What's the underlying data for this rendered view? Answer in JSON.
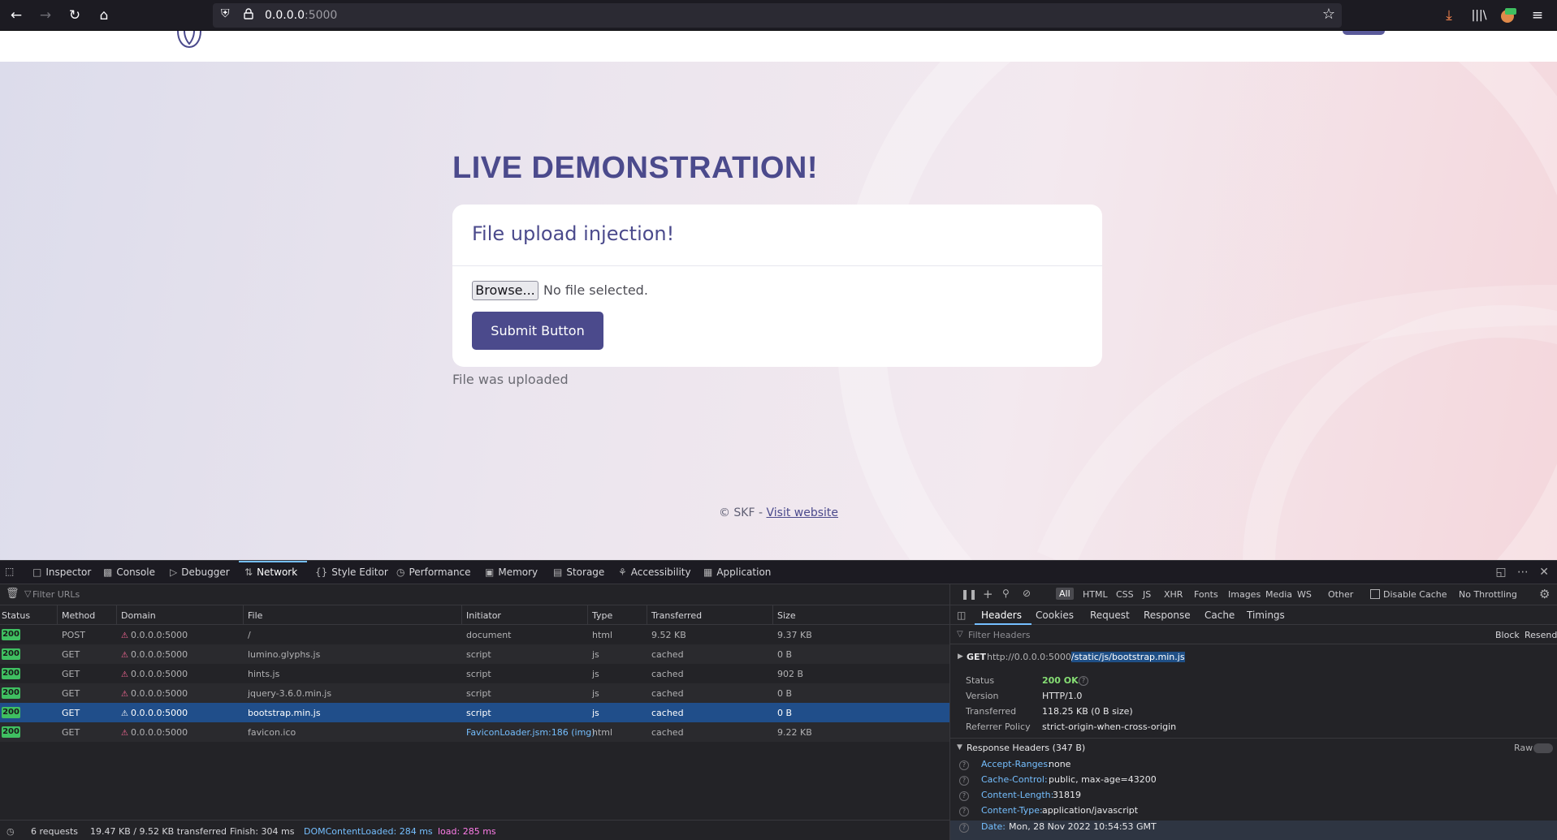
{
  "browser": {
    "url_host": "0.0.0.0",
    "url_port": ":5000"
  },
  "page": {
    "title": "LIVE DEMONSTRATION!",
    "card_title": "File upload injection!",
    "browse_label": "Browse...",
    "no_file_text": "No file selected.",
    "submit_label": "Submit Button",
    "upload_message": "File was uploaded",
    "footer_prefix": "© SKF - ",
    "footer_link": "Visit website"
  },
  "devtools": {
    "tabs": [
      {
        "label": "Inspector",
        "icon": "inspector-icon"
      },
      {
        "label": "Console",
        "icon": "console-icon"
      },
      {
        "label": "Debugger",
        "icon": "debugger-icon"
      },
      {
        "label": "Network",
        "icon": "network-icon"
      },
      {
        "label": "Style Editor",
        "icon": "style-editor-icon"
      },
      {
        "label": "Performance",
        "icon": "performance-icon"
      },
      {
        "label": "Memory",
        "icon": "memory-icon"
      },
      {
        "label": "Storage",
        "icon": "storage-icon"
      },
      {
        "label": "Accessibility",
        "icon": "accessibility-icon"
      },
      {
        "label": "Application",
        "icon": "application-icon"
      }
    ],
    "filter_placeholder": "Filter URLs",
    "filter_types": [
      "All",
      "HTML",
      "CSS",
      "JS",
      "XHR",
      "Fonts",
      "Images",
      "Media",
      "WS",
      "Other"
    ],
    "disable_cache": "Disable Cache",
    "throttling": "No Throttling",
    "columns": [
      "Status",
      "Method",
      "Domain",
      "File",
      "Initiator",
      "Type",
      "Transferred",
      "Size"
    ],
    "requests": [
      {
        "status": "200",
        "method": "POST",
        "domain": "0.0.0.0:5000",
        "file": "/",
        "initiator": "document",
        "type": "html",
        "transferred": "9.52 KB",
        "size": "9.37 KB"
      },
      {
        "status": "200",
        "method": "GET",
        "domain": "0.0.0.0:5000",
        "file": "lumino.glyphs.js",
        "initiator": "script",
        "type": "js",
        "transferred": "cached",
        "size": "0 B"
      },
      {
        "status": "200",
        "method": "GET",
        "domain": "0.0.0.0:5000",
        "file": "hints.js",
        "initiator": "script",
        "type": "js",
        "transferred": "cached",
        "size": "902 B"
      },
      {
        "status": "200",
        "method": "GET",
        "domain": "0.0.0.0:5000",
        "file": "jquery-3.6.0.min.js",
        "initiator": "script",
        "type": "js",
        "transferred": "cached",
        "size": "0 B"
      },
      {
        "status": "200",
        "method": "GET",
        "domain": "0.0.0.0:5000",
        "file": "bootstrap.min.js",
        "initiator": "script",
        "type": "js",
        "transferred": "cached",
        "size": "0 B"
      },
      {
        "status": "200",
        "method": "GET",
        "domain": "0.0.0.0:5000",
        "file": "favicon.ico",
        "initiator": "FaviconLoader.jsm:186 (img)",
        "type": "html",
        "transferred": "cached",
        "size": "9.22 KB"
      }
    ],
    "summary": {
      "requests": "6 requests",
      "transferred": "19.47 KB / 9.52 KB transferred",
      "finish": "Finish: 304 ms",
      "domcontentloaded": "DOMContentLoaded: 284 ms",
      "load": "load: 285 ms"
    },
    "side": {
      "tabs": [
        "Headers",
        "Cookies",
        "Request",
        "Response",
        "Cache",
        "Timings"
      ],
      "filter_placeholder": "Filter Headers",
      "block": "Block",
      "resend": "Resend",
      "request_method": "GET",
      "request_url_base": "http://0.0.0.0:5000",
      "request_url_path": "/static/js/bootstrap.min.js",
      "status_label": "Status",
      "status_value": "200 OK",
      "version_label": "Version",
      "version_value": "HTTP/1.0",
      "transferred_label": "Transferred",
      "transferred_value": "118.25 KB (0 B size)",
      "referrer_label": "Referrer Policy",
      "referrer_value": "strict-origin-when-cross-origin",
      "response_headers_title": "Response Headers (347 B)",
      "raw_label": "Raw",
      "headers": [
        {
          "name": "Accept-Ranges:",
          "value": "none"
        },
        {
          "name": "Cache-Control:",
          "value": "public, max-age=43200"
        },
        {
          "name": "Content-Length:",
          "value": "31819"
        },
        {
          "name": "Content-Type:",
          "value": "application/javascript"
        },
        {
          "name": "Date:",
          "value": "Mon, 28 Nov 2022 10:54:53 GMT"
        }
      ]
    }
  }
}
